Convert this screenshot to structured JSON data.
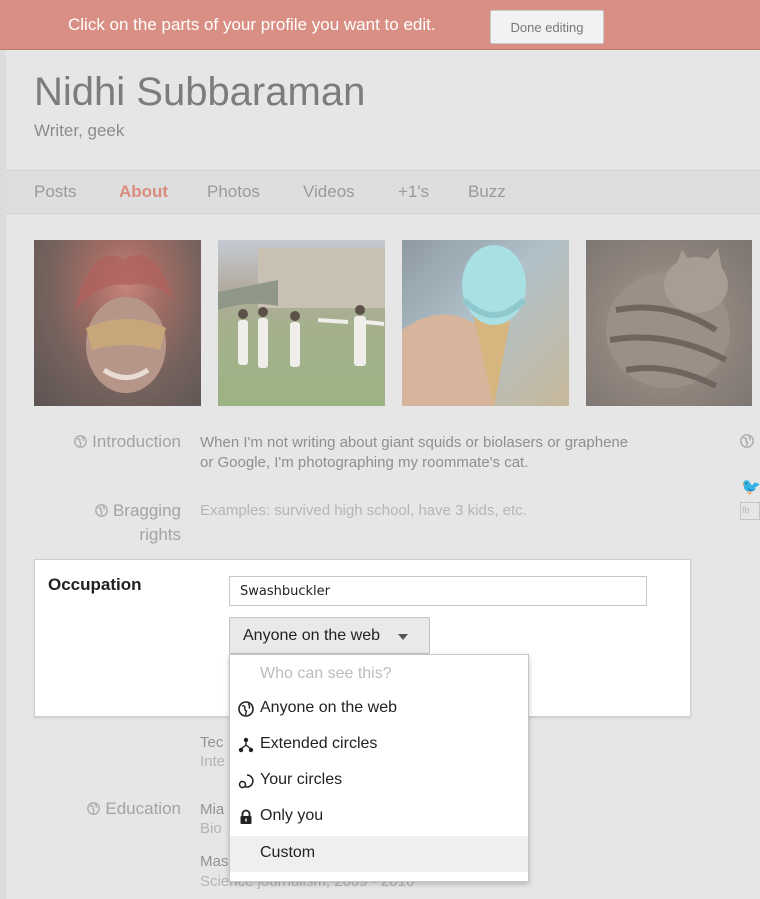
{
  "banner": {
    "message": "Click on the parts of your profile you want to edit.",
    "done_label": "Done editing"
  },
  "profile": {
    "name": "Nidhi Subbaraman",
    "tagline": "Writer, geek"
  },
  "tabs": [
    {
      "label": "Posts",
      "active": false
    },
    {
      "label": "About",
      "active": true
    },
    {
      "label": "Photos",
      "active": false
    },
    {
      "label": "Videos",
      "active": false
    },
    {
      "label": "+1's",
      "active": false
    },
    {
      "label": "Buzz",
      "active": false
    }
  ],
  "fields": {
    "introduction": {
      "label": "Introduction",
      "line1": "When I'm not writing about giant squids or biolasers or graphene",
      "line2": "or Google, I'm photographing my roommate's cat."
    },
    "bragging": {
      "label_line1": "Bragging",
      "label_line2": "rights",
      "placeholder": "Examples: survived high school, have 3 kids, etc."
    },
    "occupation": {
      "label": "Occupation",
      "value": "Swashbuckler",
      "visibility": "Anyone on the web"
    },
    "education": {
      "label": "Education"
    }
  },
  "background_fragments": {
    "employment_1": "Tec",
    "employment_2": "Inte",
    "education_1": "Mia",
    "education_2": "Bio",
    "education_3": "Mas",
    "education_4": "Science journalism, 2009 - 2010"
  },
  "visibility_menu": {
    "header": "Who can see this?",
    "items": [
      {
        "label": "Anyone on the web",
        "icon": "globe-icon"
      },
      {
        "label": "Extended circles",
        "icon": "extended-circles-icon"
      },
      {
        "label": "Your circles",
        "icon": "circles-icon"
      },
      {
        "label": "Only you",
        "icon": "lock-icon"
      },
      {
        "label": "Custom",
        "icon": ""
      }
    ],
    "highlighted_index": 4
  },
  "side_panel": {
    "box_text": "fb"
  },
  "colors": {
    "banner": "#d98f83",
    "active_tab": "#d98c7e",
    "twitter": "#7db3d3"
  }
}
